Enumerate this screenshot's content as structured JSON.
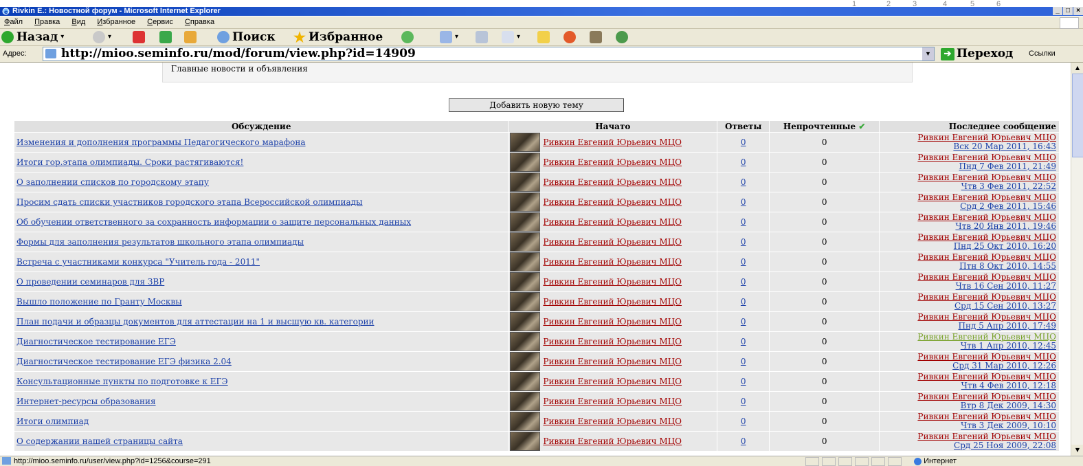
{
  "window": {
    "title": "Rivkin E.: Новостной форум - Microsoft Internet Explorer",
    "controls": [
      "_",
      "□",
      "×"
    ],
    "decor_digits": [
      "1",
      "2",
      "3",
      "4",
      "5",
      "6"
    ]
  },
  "menu": [
    {
      "key": "Ф",
      "rest": "айл"
    },
    {
      "key": "П",
      "rest": "равка"
    },
    {
      "key": "В",
      "rest": "ид"
    },
    {
      "key": "И",
      "rest": "збранное"
    },
    {
      "key": "С",
      "rest": "ервис"
    },
    {
      "key": "С",
      "rest": "правка"
    }
  ],
  "toolbar": {
    "back": "Назад",
    "search": "Поиск",
    "favorites": "Избранное"
  },
  "address": {
    "label": "Адрес:",
    "url": "http://mioo.seminfo.ru/mod/forum/view.php?id=14909",
    "go": "Переход",
    "links": "Ссылки"
  },
  "forum": {
    "intro": "Главные новости и объявления",
    "add_topic": "Добавить новую тему",
    "headers": {
      "discussion": "Обсуждение",
      "started": "Начато",
      "replies": "Ответы",
      "unread": "Непрочтенные",
      "last_post": "Последнее сообщение"
    },
    "rows": [
      {
        "topic": "Изменения и дополнения программы Педагогического марафона",
        "author": "Ривкин Евгений Юрьевич МЦО",
        "replies": "0",
        "unread": "0",
        "last_author": "Ривкин Евгений Юрьевич МЦО",
        "last_date": "Вск 20 Мар 2011, 16:43"
      },
      {
        "topic": "Итоги гор.этапа олимпиады. Сроки растягиваются!",
        "author": "Ривкин Евгений Юрьевич МЦО",
        "replies": "0",
        "unread": "0",
        "last_author": "Ривкин Евгений Юрьевич МЦО",
        "last_date": "Пнд 7 Фев 2011, 21:49"
      },
      {
        "topic": "О заполнении списков по городскому этапу",
        "author": "Ривкин Евгений Юрьевич МЦО",
        "replies": "0",
        "unread": "0",
        "last_author": "Ривкин Евгений Юрьевич МЦО",
        "last_date": "Чтв 3 Фев 2011, 22:52"
      },
      {
        "topic": "Просим сдать списки участников городского этапа Всероссийской олимпиады",
        "author": "Ривкин Евгений Юрьевич МЦО",
        "replies": "0",
        "unread": "0",
        "last_author": "Ривкин Евгений Юрьевич МЦО",
        "last_date": "Срд 2 Фев 2011, 15:46"
      },
      {
        "topic": "Об обучении ответственного за сохранность информации о защите персональных данных",
        "author": "Ривкин Евгений Юрьевич МЦО",
        "replies": "0",
        "unread": "0",
        "last_author": "Ривкин Евгений Юрьевич МЦО",
        "last_date": "Чтв 20 Янв 2011, 19:46"
      },
      {
        "topic": "Формы для заполнения результатов школьного этапа олимпиады",
        "author": "Ривкин Евгений Юрьевич МЦО",
        "replies": "0",
        "unread": "0",
        "last_author": "Ривкин Евгений Юрьевич МЦО",
        "last_date": "Пнд 25 Окт 2010, 16:20"
      },
      {
        "topic": "Встреча с участниками конкурса \"Учитель года - 2011\"",
        "author": "Ривкин Евгений Юрьевич МЦО",
        "replies": "0",
        "unread": "0",
        "last_author": "Ривкин Евгений Юрьевич МЦО",
        "last_date": "Птн 8 Окт 2010, 14:55"
      },
      {
        "topic": "О проведении семинаров для ЗВР",
        "author": "Ривкин Евгений Юрьевич МЦО",
        "replies": "0",
        "unread": "0",
        "last_author": "Ривкин Евгений Юрьевич МЦО",
        "last_date": "Чтв 16 Сен 2010, 11:27"
      },
      {
        "topic": "Вышло положение по Гранту Москвы",
        "author": "Ривкин Евгений Юрьевич МЦО",
        "replies": "0",
        "unread": "0",
        "last_author": "Ривкин Евгений Юрьевич МЦО",
        "last_date": "Срд 15 Сен 2010, 13:27"
      },
      {
        "topic": "План подачи и образцы документов для аттестации на 1 и высшую кв. категории",
        "author": "Ривкин Евгений Юрьевич МЦО",
        "replies": "0",
        "unread": "0",
        "last_author": "Ривкин Евгений Юрьевич МЦО",
        "last_date": "Пнд 5 Апр 2010, 17:49"
      },
      {
        "topic": "Диагностическое тестирование ЕГЭ",
        "author": "Ривкин Евгений Юрьевич МЦО",
        "replies": "0",
        "unread": "0",
        "last_author": "Ривкин Евгений Юрьевич МЦО",
        "last_date": "Чтв 1 Апр 2010, 12:45",
        "last_author_color": "#79a12a"
      },
      {
        "topic": "Диагностическое тестирование ЕГЭ физика 2.04",
        "author": "Ривкин Евгений Юрьевич МЦО",
        "replies": "0",
        "unread": "0",
        "last_author": "Ривкин Евгений Юрьевич МЦО",
        "last_date": "Срд 31 Мар 2010, 12:26"
      },
      {
        "topic": "Консультационные пункты по подготовке к ЕГЭ",
        "author": "Ривкин Евгений Юрьевич МЦО",
        "replies": "0",
        "unread": "0",
        "last_author": "Ривкин Евгений Юрьевич МЦО",
        "last_date": "Чтв 4 Фев 2010, 12:18"
      },
      {
        "topic": "Интернет-ресурсы образования",
        "author": "Ривкин Евгений Юрьевич МЦО",
        "replies": "0",
        "unread": "0",
        "last_author": "Ривкин Евгений Юрьевич МЦО",
        "last_date": "Втр 8 Дек 2009, 14:30"
      },
      {
        "topic": "Итоги олимпиад",
        "author": "Ривкин Евгений Юрьевич МЦО",
        "replies": "0",
        "unread": "0",
        "last_author": "Ривкин Евгений Юрьевич МЦО",
        "last_date": "Чтв 3 Дек 2009, 10:10"
      },
      {
        "topic": "О содержании нашей страницы сайта",
        "author": "Ривкин Евгений Юрьевич МЦО",
        "replies": "0",
        "unread": "0",
        "last_author": "Ривкин Евгений Юрьевич МЦО",
        "last_date": "Срд 25 Ноя 2009, 22:08"
      }
    ]
  },
  "status": {
    "text": "http://mioo.seminfo.ru/user/view.php?id=1256&course=291",
    "zone": "Интернет"
  },
  "colors": {
    "link": "#1a3fa8",
    "author_link": "#a20000",
    "titlebar": "#0a3fb8"
  }
}
